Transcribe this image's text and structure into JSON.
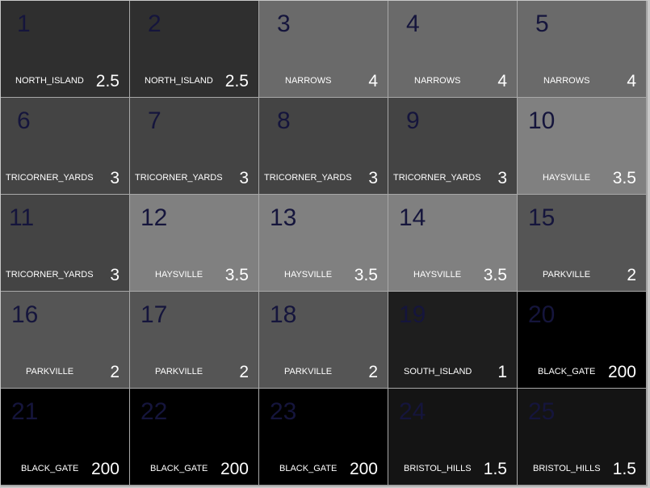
{
  "board": {
    "tiles": [
      {
        "id": "1",
        "name": "NORTH_ISLAND",
        "cost": "2.5",
        "color": "#2f2f2f"
      },
      {
        "id": "2",
        "name": "NORTH_ISLAND",
        "cost": "2.5",
        "color": "#2f2f2f"
      },
      {
        "id": "3",
        "name": "NARROWS",
        "cost": "4",
        "color": "#6a6a6a"
      },
      {
        "id": "4",
        "name": "NARROWS",
        "cost": "4",
        "color": "#6a6a6a"
      },
      {
        "id": "5",
        "name": "NARROWS",
        "cost": "4",
        "color": "#6a6a6a"
      },
      {
        "id": "6",
        "name": "TRICORNER_YARDS",
        "cost": "3",
        "color": "#444444"
      },
      {
        "id": "7",
        "name": "TRICORNER_YARDS",
        "cost": "3",
        "color": "#444444"
      },
      {
        "id": "8",
        "name": "TRICORNER_YARDS",
        "cost": "3",
        "color": "#444444"
      },
      {
        "id": "9",
        "name": "TRICORNER_YARDS",
        "cost": "3",
        "color": "#444444"
      },
      {
        "id": "10",
        "name": "HAYSVILLE",
        "cost": "3.5",
        "color": "#808080"
      },
      {
        "id": "11",
        "name": "TRICORNER_YARDS",
        "cost": "3",
        "color": "#444444"
      },
      {
        "id": "12",
        "name": "HAYSVILLE",
        "cost": "3.5",
        "color": "#808080"
      },
      {
        "id": "13",
        "name": "HAYSVILLE",
        "cost": "3.5",
        "color": "#808080"
      },
      {
        "id": "14",
        "name": "HAYSVILLE",
        "cost": "3.5",
        "color": "#808080"
      },
      {
        "id": "15",
        "name": "PARKVILLE",
        "cost": "2",
        "color": "#555555"
      },
      {
        "id": "16",
        "name": "PARKVILLE",
        "cost": "2",
        "color": "#555555"
      },
      {
        "id": "17",
        "name": "PARKVILLE",
        "cost": "2",
        "color": "#555555"
      },
      {
        "id": "18",
        "name": "PARKVILLE",
        "cost": "2",
        "color": "#555555"
      },
      {
        "id": "19",
        "name": "SOUTH_ISLAND",
        "cost": "1",
        "color": "#1e1e1e"
      },
      {
        "id": "20",
        "name": "BLACK_GATE",
        "cost": "200",
        "color": "#000000"
      },
      {
        "id": "21",
        "name": "BLACK_GATE",
        "cost": "200",
        "color": "#000000"
      },
      {
        "id": "22",
        "name": "BLACK_GATE",
        "cost": "200",
        "color": "#000000"
      },
      {
        "id": "23",
        "name": "BLACK_GATE",
        "cost": "200",
        "color": "#000000"
      },
      {
        "id": "24",
        "name": "BRISTOL_HILLS",
        "cost": "1.5",
        "color": "#141414"
      },
      {
        "id": "25",
        "name": "BRISTOL_HILLS",
        "cost": "1.5",
        "color": "#141414"
      }
    ]
  }
}
